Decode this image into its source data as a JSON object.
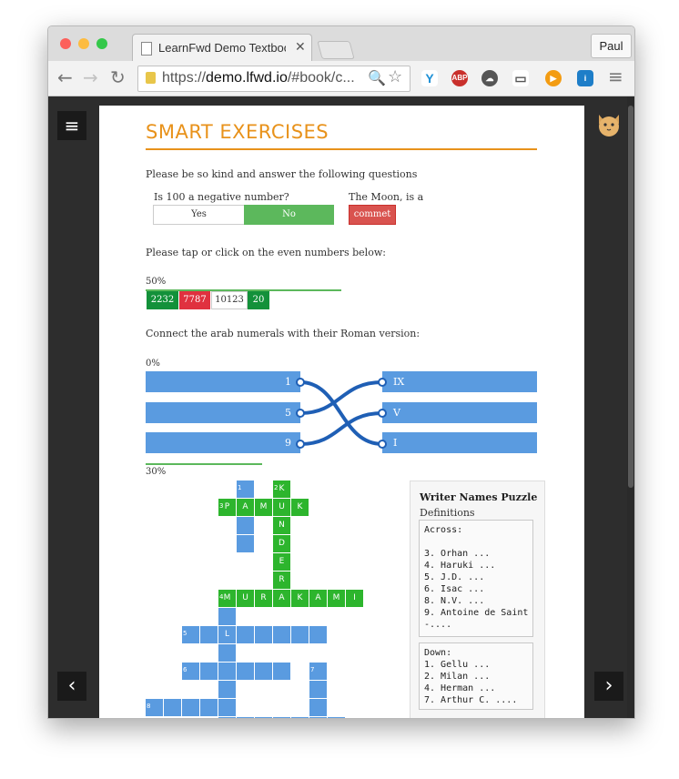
{
  "browser": {
    "tab_title": "LearnFwd Demo Textbook",
    "tab_close": "✕",
    "profile": "Paul",
    "url_prefix": "https://",
    "url_domain": "demo.lfwd.io",
    "url_rest": "/#book/c...",
    "extensions": [
      "Y",
      "ABP",
      "☁",
      "▭",
      "▶",
      "i"
    ]
  },
  "page": {
    "title": "SMART EXERCISES",
    "intro": "Please be so kind and answer the following questions",
    "q1": {
      "text": "Is 100 a negative number?",
      "yes": "Yes",
      "no": "No"
    },
    "q2": {
      "text": "The Moon, is a",
      "answer": "commet"
    },
    "even_prompt": "Please tap or click on the even numbers below:",
    "even_progress": "50%",
    "numbers": [
      "2232",
      "7787",
      "10123",
      "20"
    ],
    "connect_prompt": "Connect the arab numerals with their Roman version:",
    "connect_progress": "0%",
    "arab": [
      "1",
      "5",
      "9"
    ],
    "roman": [
      "IX",
      "V",
      "I"
    ],
    "crossword_progress": "30%"
  },
  "crossword": {
    "numbers": {
      "n1": "1",
      "n2": "2",
      "n3": "3",
      "n4": "4",
      "n5": "5",
      "n6": "6",
      "n7": "7",
      "n8": "8"
    },
    "row3_letters": [
      "P",
      "A",
      "M",
      "U",
      "K"
    ],
    "col2_letters": [
      "K",
      "U",
      "N",
      "D",
      "E",
      "R"
    ],
    "row4_letters": [
      "M",
      "U",
      "R",
      "A",
      "K",
      "A",
      "M",
      "I"
    ],
    "row5_letter": "L"
  },
  "puzzle": {
    "title": "Writer Names Puzzle",
    "subtitle": "Definitions",
    "across_label": "Across:",
    "across": [
      "3. Orhan ...",
      "4. Haruki ...",
      "5. J.D. ...",
      "6. Isac ...",
      "8. N.V. ...",
      "9. Antoine de Saint",
      "-...."
    ],
    "down_label": "Down:",
    "down": [
      "1. Gellu ...",
      "2. Milan ...",
      "4. Herman ...",
      "7. Arthur C. ...."
    ]
  },
  "colors": {
    "accent": "#e8921b",
    "correct": "#5cb85c",
    "wrong": "#d9534f",
    "blue": "#5a9be0",
    "green_cell": "#2db52d"
  },
  "icons": [
    "hamburger-menu-icon",
    "cat-avatar-icon",
    "chevron-left-icon",
    "chevron-right-icon"
  ]
}
